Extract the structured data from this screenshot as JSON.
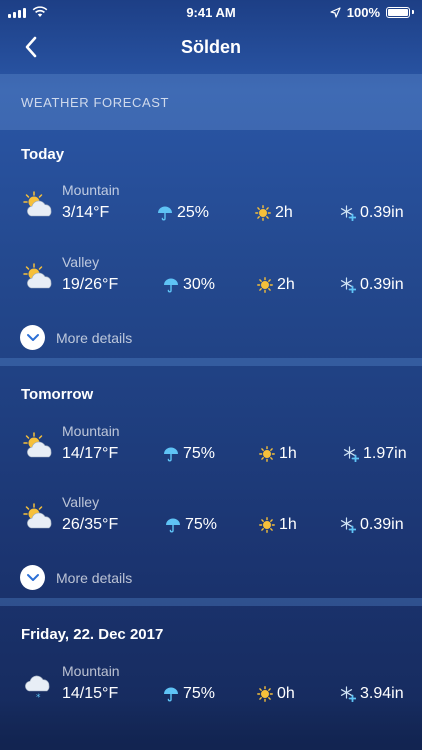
{
  "status": {
    "time": "9:41 AM",
    "battery": "100%"
  },
  "nav": {
    "title": "Sölden"
  },
  "section": {
    "label": "WEATHER FORECAST"
  },
  "days": [
    {
      "title": "Today",
      "rows": [
        {
          "zone": "Mountain",
          "temp": "3/14°F",
          "precip": "25%",
          "sun": "2h",
          "snow": "0.39in"
        },
        {
          "zone": "Valley",
          "temp": "19/26°F",
          "precip": "30%",
          "sun": "2h",
          "snow": "0.39in"
        }
      ],
      "details": "More details"
    },
    {
      "title": "Tomorrow",
      "rows": [
        {
          "zone": "Mountain",
          "temp": "14/17°F",
          "precip": "75%",
          "sun": "1h",
          "snow": "1.97in"
        },
        {
          "zone": "Valley",
          "temp": "26/35°F",
          "precip": "75%",
          "sun": "1h",
          "snow": "0.39in"
        }
      ],
      "details": "More details"
    },
    {
      "title": "Friday, 22. Dec 2017",
      "rows": [
        {
          "zone": "Mountain",
          "temp": "14/15°F",
          "precip": "75%",
          "sun": "0h",
          "snow": "3.94in"
        }
      ]
    }
  ],
  "icons": {
    "back": "chevron-left-icon",
    "partly_cloudy": "partly-cloudy-icon",
    "snow_cloud": "snow-cloud-icon",
    "umbrella": "umbrella-icon",
    "sun": "sun-icon",
    "snowflake": "snowflake-plus-icon",
    "details": "chevron-down-icon"
  },
  "colors": {
    "accent_blue": "#5fc3f5",
    "sun_yellow": "#f6c03a",
    "details_chevron": "#2b6fd6"
  }
}
